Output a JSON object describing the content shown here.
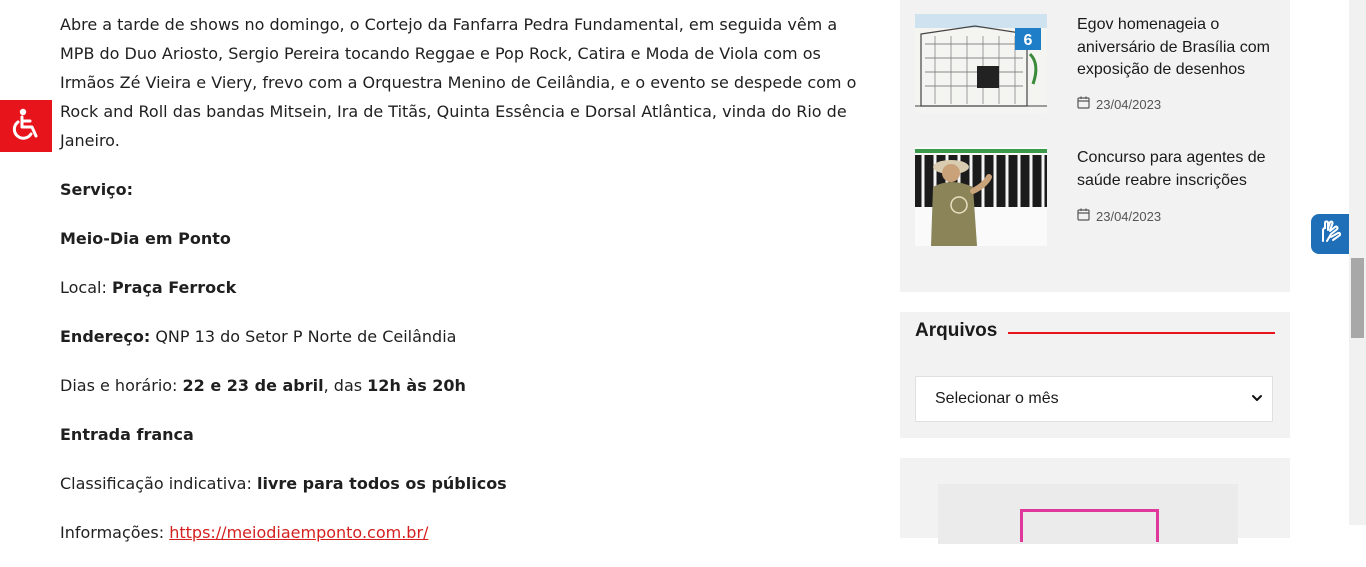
{
  "article": {
    "lead_text": "Abre a tarde de shows no domingo, o Cortejo da Fanfarra Pedra Fundamental, em seguida vêm a MPB do Duo Ariosto, Sergio Pereira tocando Reggae e Pop Rock, Catira e Moda de Viola com os Irmãos Zé Vieira e Viery, frevo com a Orquestra Menino de Ceilândia, e o evento se despede com o Rock and Roll das bandas Mitsein, Ira de Titãs, Quinta Essência e Dorsal Atlântica, vinda do Rio de Janeiro.",
    "servico": "Serviço:",
    "event_name": "Meio-Dia em Ponto",
    "local_label": "Local: ",
    "local_value": "Praça Ferrock",
    "endereco_label": "Endereço:",
    "endereco_value": " QNP 13 do Setor P Norte de Ceilândia",
    "dias_label": "Dias e horário: ",
    "dias_value": "22 e 23 de abril",
    "das": ", das ",
    "horario_value": "12h às 20h",
    "entrada": "Entrada franca",
    "classificacao_label": "Classificação indicativa: ",
    "classificacao_value": "livre para todos os públicos",
    "info_label": "Informações: ",
    "info_link": "https://meiodiaemponto.com.br/"
  },
  "sidebar": {
    "recent_posts": [
      {
        "title": "Egov homenageia o aniversário de Brasília com exposição de desenhos",
        "date": "23/04/2023",
        "thumb_icon": "sketch-building-thumbnail"
      },
      {
        "title": "Concurso para agentes de saúde reabre inscrições",
        "date": "23/04/2023",
        "thumb_icon": "health-agent-thumbnail"
      }
    ],
    "archives": {
      "title": "Arquivos",
      "select_value": "Selecionar o mês"
    }
  },
  "icons": {
    "accessibility": "wheelchair-icon",
    "libras": "sign-language-hands-icon",
    "calendar": "calendar-icon",
    "chevron": "chevron-down-icon"
  },
  "colors": {
    "accent": "#e8141b",
    "link": "#d42020",
    "libras_blue": "#1f6fb8",
    "sidebar_bg": "#f2f2f2"
  }
}
